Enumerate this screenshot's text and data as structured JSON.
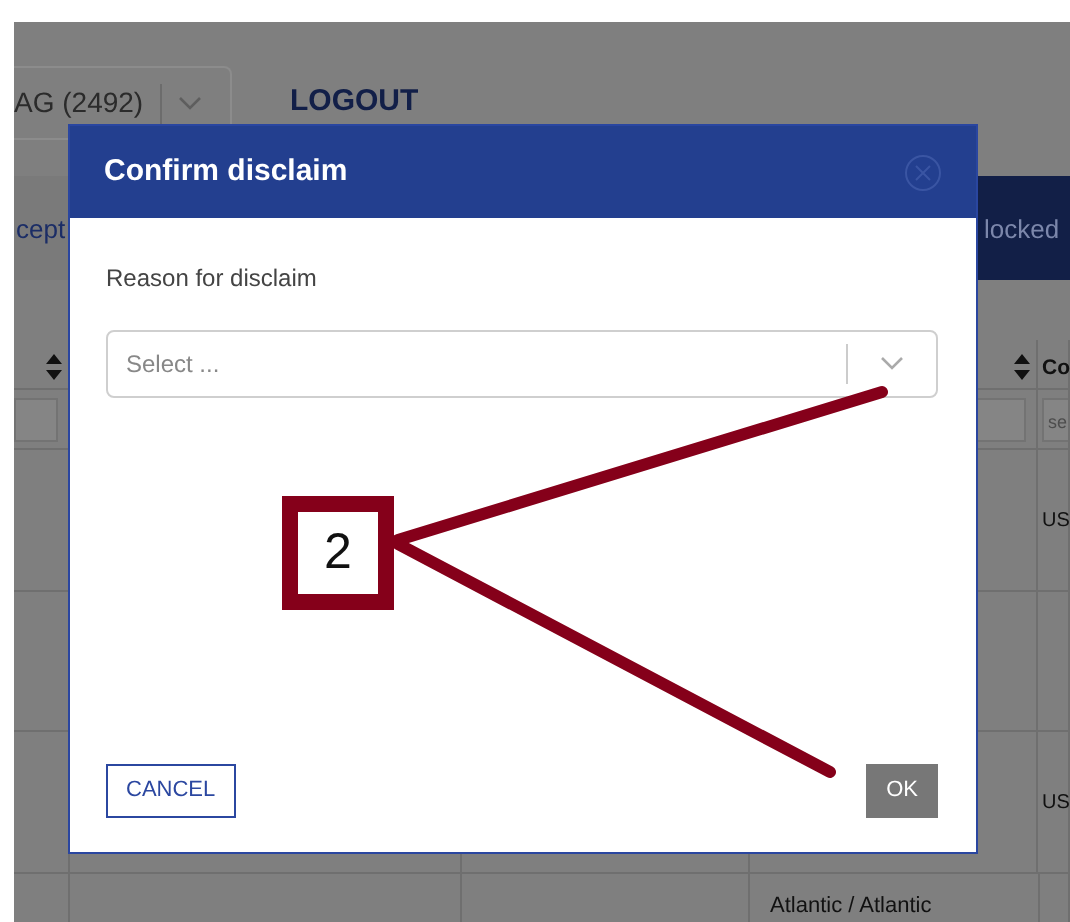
{
  "app": {
    "account_select": "AG (2492)",
    "logout": "LOGOUT",
    "tabs": [
      {
        "label": "cept",
        "selected": false
      },
      {
        "label": "locked",
        "selected": true
      }
    ],
    "table": {
      "column_5_header": "Co",
      "filter_placeholder": "se",
      "rows": [
        {
          "column_5": "US"
        },
        {
          "column_5": "US"
        },
        {
          "column_4": "Atlantic / Atlantic"
        }
      ]
    }
  },
  "dialog": {
    "title": "Confirm disclaim",
    "field_label": "Reason for disclaim",
    "select_placeholder": "Select ...",
    "buttons": [
      {
        "label": "CANCEL",
        "disabled": false
      },
      {
        "label": "OK",
        "disabled": true
      }
    ]
  },
  "callout": {
    "label": "2"
  }
}
